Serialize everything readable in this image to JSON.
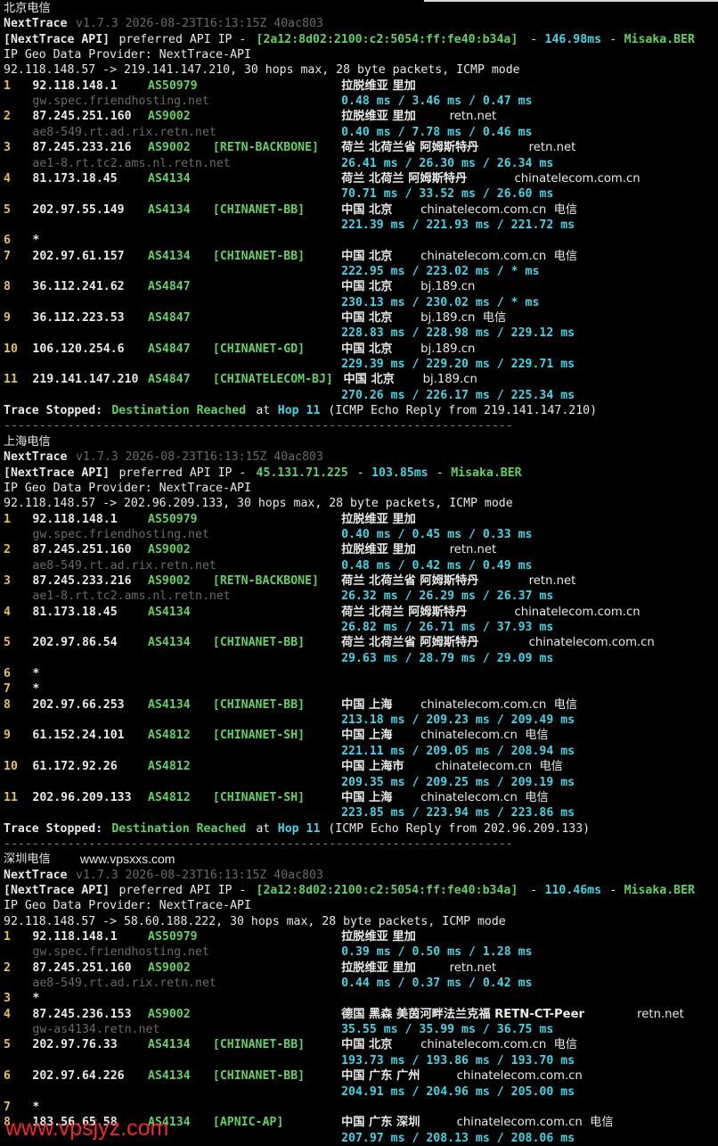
{
  "watermark_bottom": "www.vpsjyz.com",
  "watermark_url": "www.vpsxxs.com",
  "colors": {
    "background": "#000000",
    "hop_number": "#e5c24a",
    "asn": "#5fd35f",
    "latency": "#3ed6e6",
    "hostname": "#6a6a6a",
    "text": "#e8e8e8",
    "watermark": "#ff2a2a"
  },
  "sections": [
    {
      "title": "北京电信",
      "version_line": {
        "name": "NextTrace",
        "version": "v1.7.3 2026-08-23T16:13:15Z 40ac803"
      },
      "api_line": {
        "prefix": "[NextTrace API]",
        "text": " preferred API IP - ",
        "ip": "[2a12:8d02:2100:c2:5054:ff:fe40:b34a]",
        "dash": " - ",
        "latency": "146.98ms",
        "dash2": " - ",
        "node": "Misaka.BER"
      },
      "geo_provider": "IP Geo Data Provider: NextTrace-API",
      "trace_header": "92.118.148.57 -> 219.141.147.210, 30 hops max, 28 byte packets, ICMP mode",
      "hops": [
        {
          "n": "1",
          "ip": "92.118.148.1",
          "asn": "AS50979",
          "tag": "",
          "geo": "拉脱维亚 里加",
          "isp": "",
          "host": "gw.spec.friendhosting.net",
          "rtt": "0.48 ms / 3.46 ms / 0.47 ms"
        },
        {
          "n": "2",
          "ip": "87.245.251.160",
          "asn": "AS9002",
          "tag": "",
          "geo": "拉脱维亚 里加",
          "isp": "retn.net",
          "host": "ae8-549.rt.ad.rix.retn.net",
          "rtt": "0.40 ms / 7.78 ms / 0.46 ms"
        },
        {
          "n": "3",
          "ip": "87.245.233.216",
          "asn": "AS9002",
          "tag": "[RETN-BACKBONE]",
          "geo": "荷兰 北荷兰省 阿姆斯特丹",
          "isp": "retn.net",
          "host": "ae1-8.rt.tc2.ams.nl.retn.net",
          "rtt": "26.41 ms / 26.30 ms / 26.34 ms"
        },
        {
          "n": "4",
          "ip": "81.173.18.45",
          "asn": "AS4134",
          "tag": "",
          "geo": "荷兰 北荷兰 阿姆斯特丹",
          "isp": "chinatelecom.com.cn",
          "host": "",
          "rtt": "70.71 ms / 33.52 ms / 26.60 ms"
        },
        {
          "n": "5",
          "ip": "202.97.55.149",
          "asn": "AS4134",
          "tag": "[CHINANET-BB]",
          "geo": "中国 北京",
          "isp": "chinatelecom.com.cn  电信",
          "host": "",
          "rtt": "221.39 ms / 221.93 ms / 221.72 ms"
        },
        {
          "n": "6",
          "star": "*"
        },
        {
          "n": "7",
          "ip": "202.97.61.157",
          "asn": "AS4134",
          "tag": "[CHINANET-BB]",
          "geo": "中国 北京",
          "isp": "chinatelecom.com.cn  电信",
          "host": "",
          "rtt": "222.95 ms / 223.02 ms / * ms"
        },
        {
          "n": "8",
          "ip": "36.112.241.62",
          "asn": "AS4847",
          "tag": "",
          "geo": "中国 北京",
          "isp": "bj.189.cn",
          "host": "",
          "rtt": "230.13 ms / 230.02 ms / * ms"
        },
        {
          "n": "9",
          "ip": "36.112.223.53",
          "asn": "AS4847",
          "tag": "",
          "geo": "中国 北京",
          "isp": "bj.189.cn  电信",
          "host": "",
          "rtt": "228.83 ms / 228.98 ms / 229.12 ms"
        },
        {
          "n": "10",
          "ip": "106.120.254.6",
          "asn": "AS4847",
          "tag": "[CHINANET-GD]",
          "geo": "中国 北京",
          "isp": "bj.189.cn",
          "host": "",
          "rtt": "229.39 ms / 229.20 ms / 229.71 ms"
        },
        {
          "n": "11",
          "ip": "219.141.147.210",
          "asn": "AS4847",
          "tag": "[CHINATELECOM-BJ]",
          "geo": "中国 北京",
          "isp": "bj.189.cn",
          "host": "",
          "rtt": "270.26 ms / 226.17 ms / 225.34 ms"
        }
      ],
      "stopped": {
        "a": "Trace Stopped:",
        "b": " Destination Reached",
        "c": " at ",
        "d": "Hop 11",
        "e": " (ICMP Echo Reply from 219.141.147.210)"
      }
    },
    {
      "title": "上海电信",
      "version_line": {
        "name": "NextTrace",
        "version": "v1.7.3 2026-08-23T16:13:15Z 40ac803"
      },
      "api_line": {
        "prefix": "[NextTrace API]",
        "text": " preferred API IP - ",
        "ip": "45.131.71.225",
        "dash": " - ",
        "latency": "103.85ms",
        "dash2": " - ",
        "node": "Misaka.BER"
      },
      "geo_provider": "IP Geo Data Provider: NextTrace-API",
      "trace_header": "92.118.148.57 -> 202.96.209.133, 30 hops max, 28 byte packets, ICMP mode",
      "hops": [
        {
          "n": "1",
          "ip": "92.118.148.1",
          "asn": "AS50979",
          "tag": "",
          "geo": "拉脱维亚 里加",
          "isp": "",
          "host": "gw.spec.friendhosting.net",
          "rtt": "0.40 ms / 0.45 ms / 0.33 ms"
        },
        {
          "n": "2",
          "ip": "87.245.251.160",
          "asn": "AS9002",
          "tag": "",
          "geo": "拉脱维亚 里加",
          "isp": "retn.net",
          "host": "ae8-549.rt.ad.rix.retn.net",
          "rtt": "0.48 ms / 0.42 ms / 0.49 ms"
        },
        {
          "n": "3",
          "ip": "87.245.233.216",
          "asn": "AS9002",
          "tag": "[RETN-BACKBONE]",
          "geo": "荷兰 北荷兰省 阿姆斯特丹",
          "isp": "retn.net",
          "host": "ae1-8.rt.tc2.ams.nl.retn.net",
          "rtt": "26.32 ms / 26.29 ms / 26.37 ms"
        },
        {
          "n": "4",
          "ip": "81.173.18.45",
          "asn": "AS4134",
          "tag": "",
          "geo": "荷兰 北荷兰 阿姆斯特丹",
          "isp": "chinatelecom.com.cn",
          "host": "",
          "rtt": "26.82 ms / 26.71 ms / 37.93 ms"
        },
        {
          "n": "5",
          "ip": "202.97.86.54",
          "asn": "AS4134",
          "tag": "[CHINANET-BB]",
          "geo": "荷兰 北荷兰省 阿姆斯特丹",
          "isp": "chinatelecom.com.cn",
          "host": "",
          "rtt": "29.63 ms / 28.79 ms / 29.09 ms"
        },
        {
          "n": "6",
          "star": "*"
        },
        {
          "n": "7",
          "star": "*"
        },
        {
          "n": "8",
          "ip": "202.97.66.253",
          "asn": "AS4134",
          "tag": "[CHINANET-BB]",
          "geo": "中国 上海",
          "isp": "chinatelecom.com.cn  电信",
          "host": "",
          "rtt": "213.18 ms / 209.23 ms / 209.49 ms"
        },
        {
          "n": "9",
          "ip": "61.152.24.101",
          "asn": "AS4812",
          "tag": "[CHINANET-SH]",
          "geo": "中国 上海",
          "isp": "chinatelecom.cn  电信",
          "host": "",
          "rtt": "221.11 ms / 209.05 ms / 208.94 ms"
        },
        {
          "n": "10",
          "ip": "61.172.92.26",
          "asn": "AS4812",
          "tag": "",
          "geo": "中国 上海市",
          "isp": "chinatelecom.cn  电信",
          "host": "",
          "rtt": "209.35 ms / 209.25 ms / 209.19 ms"
        },
        {
          "n": "11",
          "ip": "202.96.209.133",
          "asn": "AS4812",
          "tag": "[CHINANET-SH]",
          "geo": "中国 上海",
          "isp": "chinatelecom.cn  电信",
          "host": "",
          "rtt": "223.85 ms / 223.94 ms / 223.86 ms"
        }
      ],
      "stopped": {
        "a": "Trace Stopped:",
        "b": " Destination Reached",
        "c": " at ",
        "d": "Hop 11",
        "e": " (ICMP Echo Reply from 202.96.209.133)"
      }
    },
    {
      "title": "深圳电信",
      "version_line": {
        "name": "NextTrace",
        "version": "v1.7.3 2026-08-23T16:13:15Z 40ac803"
      },
      "api_line": {
        "prefix": "[NextTrace API]",
        "text": " preferred API IP - ",
        "ip": "[2a12:8d02:2100:c2:5054:ff:fe40:b34a]",
        "dash": " - ",
        "latency": "110.46ms",
        "dash2": " - ",
        "node": "Misaka.BER"
      },
      "geo_provider": "IP Geo Data Provider: NextTrace-API",
      "trace_header": "92.118.148.57 -> 58.60.188.222, 30 hops max, 28 byte packets, ICMP mode",
      "hops": [
        {
          "n": "1",
          "ip": "92.118.148.1",
          "asn": "AS50979",
          "tag": "",
          "geo": "拉脱维亚 里加",
          "isp": "",
          "host": "gw.spec.friendhosting.net",
          "rtt": "0.39 ms / 0.50 ms / 1.28 ms"
        },
        {
          "n": "2",
          "ip": "87.245.251.160",
          "asn": "AS9002",
          "tag": "",
          "geo": "拉脱维亚 里加",
          "isp": "retn.net",
          "host": "ae8-549.rt.ad.rix.retn.net",
          "rtt": "0.44 ms / 0.37 ms / 0.42 ms"
        },
        {
          "n": "3",
          "star": "*"
        },
        {
          "n": "4",
          "ip": "87.245.236.153",
          "asn": "AS9002",
          "tag": "",
          "geo": "德国 黑森 美茵河畔法兰克福 RETN-CT-Peer",
          "isp": "retn.net",
          "host": "gw-as4134.retn.net",
          "rtt": "35.55 ms / 35.99 ms / 36.75 ms"
        },
        {
          "n": "5",
          "ip": "202.97.76.33",
          "asn": "AS4134",
          "tag": "[CHINANET-BB]",
          "geo": "中国 北京",
          "isp": "chinatelecom.com.cn  电信",
          "host": "",
          "rtt": "193.73 ms / 193.86 ms / 193.70 ms"
        },
        {
          "n": "6",
          "ip": "202.97.64.226",
          "asn": "AS4134",
          "tag": "[CHINANET-BB]",
          "geo": "中国 广东 广州",
          "isp": "chinatelecom.com.cn",
          "host": "",
          "rtt": "204.91 ms / 204.96 ms / 205.00 ms"
        },
        {
          "n": "7",
          "star": "*"
        },
        {
          "n": "8",
          "ip": "183.56.65.58",
          "asn": "AS4134",
          "tag": "[APNIC-AP]",
          "geo": "中国 广东 深圳",
          "isp": "chinatelecom.com.cn  电信",
          "host": "",
          "rtt": "207.97 ms / 208.13 ms / 208.06 ms"
        }
      ]
    }
  ],
  "separator": "------------------------------------------------------------------------"
}
